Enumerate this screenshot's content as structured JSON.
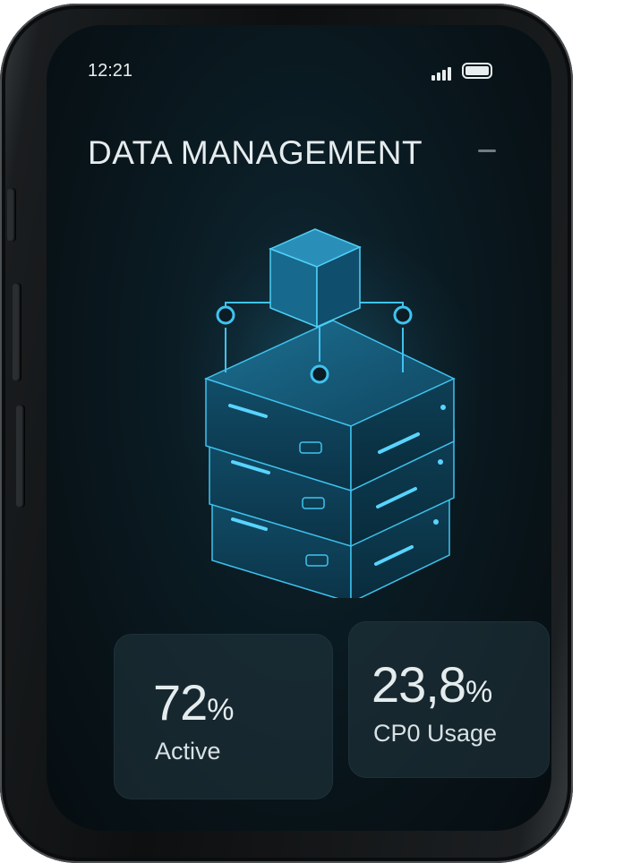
{
  "status": {
    "time": "12:21"
  },
  "header": {
    "title": "DATA MANAGEMENT"
  },
  "stats": [
    {
      "value": "72",
      "unit": "%",
      "label": "Active"
    },
    {
      "value": "23,8",
      "unit": "%",
      "label": "CP0 Usage"
    }
  ],
  "colors": {
    "accent": "#2fb6e8",
    "screen_bg": "#0b1c24",
    "card_bg": "#233740"
  },
  "icons": [
    "signal-icon",
    "battery-icon",
    "menu-dash-icon",
    "server-stack-illustration"
  ]
}
